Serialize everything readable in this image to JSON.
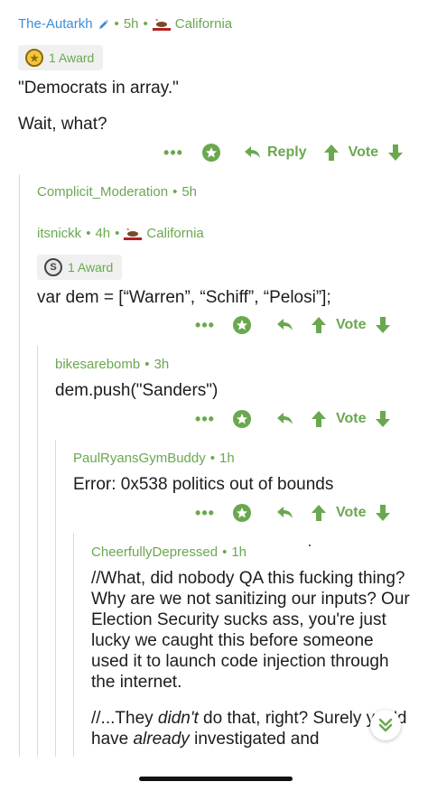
{
  "comments": [
    {
      "user": "The-Autarkh",
      "time": "5h",
      "flair": "California",
      "award": "1 Award",
      "lines": [
        "\"Democrats in array.\"",
        "Wait, what?"
      ],
      "actions": {
        "more": "•••",
        "reply": "Reply",
        "vote": "Vote"
      }
    },
    {
      "user": "Complicit_Moderation",
      "time": "5h"
    },
    {
      "user": "itsnickk",
      "time": "4h",
      "flair": "California",
      "award": "1 Award",
      "lines": [
        "var dem = [“Warren”, “Schiff”, “Pelosi”];"
      ],
      "actions": {
        "more": "•••",
        "vote": "Vote"
      }
    },
    {
      "user": "bikesarebomb",
      "time": "3h",
      "lines": [
        "dem.push(\"Sanders\")"
      ],
      "actions": {
        "more": "•••",
        "vote": "Vote"
      }
    },
    {
      "user": "PaulRyansGymBuddy",
      "time": "1h",
      "lines": [
        "Error: 0x538 politics out of bounds"
      ],
      "actions": {
        "more": "•••",
        "vote": "Vote"
      }
    },
    {
      "user": "CheerfullyDepressed",
      "time": "1h",
      "p1": "//What, did nobody QA this fucking thing? Why are we not sanitizing our inputs? Our Election Security sucks ass, you're just lucky we caught this before someone used it to launch code injection through the internet.",
      "p2_a": "//...They ",
      "p2_em1": "didn't",
      "p2_b": " do that, right? Surely you'd have ",
      "p2_em2": "already",
      "p2_c": " investigated and"
    }
  ],
  "separator": "•",
  "colors": {
    "accent": "#6aa84f",
    "username_top": "#3b8ed8"
  },
  "icons": [
    "pencil-icon",
    "california-flag-icon",
    "medal-icon",
    "award-badge-icon",
    "reply-arrow-icon",
    "upvote-icon",
    "downvote-icon",
    "scroll-down-icon"
  ]
}
